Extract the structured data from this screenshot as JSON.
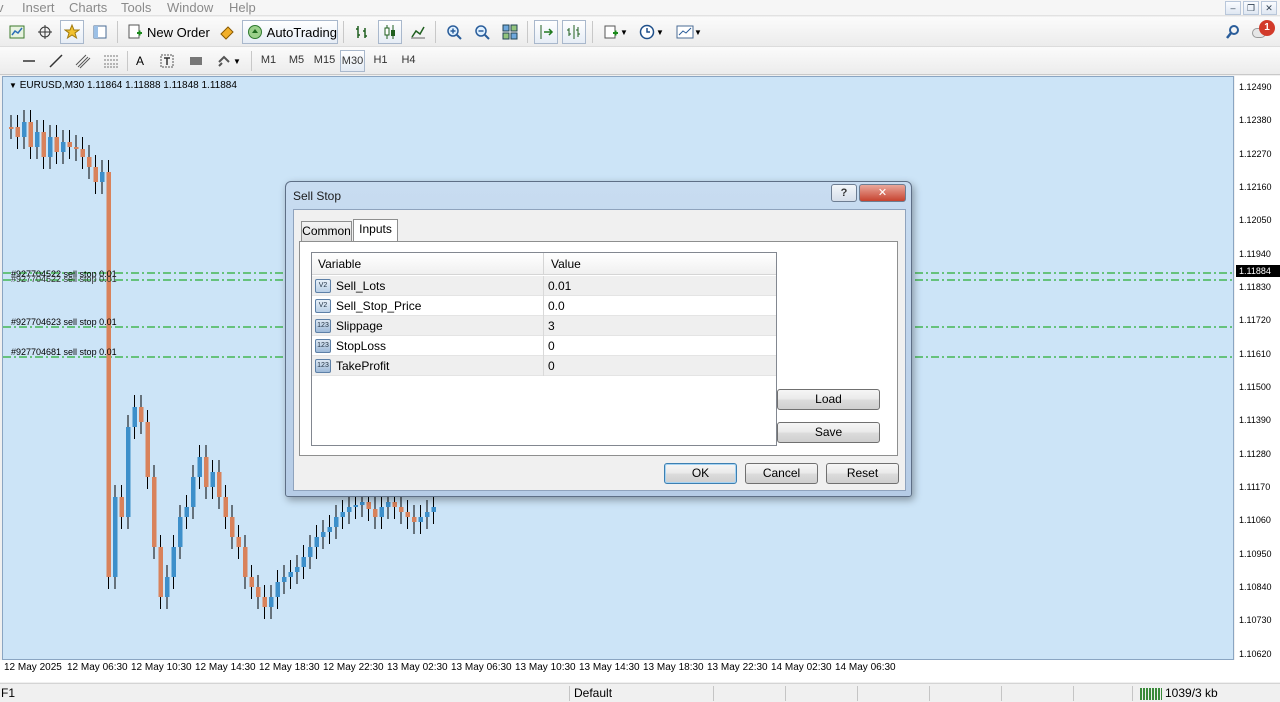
{
  "menu": {
    "items": [
      "Insert",
      "Charts",
      "Tools",
      "Window",
      "Help"
    ]
  },
  "toolbar": {
    "new_order_label": "New Order",
    "autotrading_label": "AutoTrading"
  },
  "timeframes": [
    "M1",
    "M5",
    "M15",
    "M30",
    "H1",
    "H4"
  ],
  "timeframe_active": "M30",
  "chart": {
    "title": "EURUSD,M30  1.11864 1.11888 1.11848 1.11884",
    "order_labels": [
      "#927704522 sell stop 0.01",
      "#927704623 sell stop 0.01",
      "#927704681 sell stop 0.01"
    ],
    "price_ticks": [
      "1.12490",
      "1.12380",
      "1.12270",
      "1.12160",
      "1.12050",
      "1.11940",
      "1.11830",
      "1.11720",
      "1.11610",
      "1.11500",
      "1.11390",
      "1.11280",
      "1.11170",
      "1.11060",
      "1.10950",
      "1.10840",
      "1.10730",
      "1.10620"
    ],
    "current_price": "1.11884",
    "time_ticks": [
      "12 May 2025",
      "12 May 06:30",
      "12 May 10:30",
      "12 May 14:30",
      "12 May 18:30",
      "12 May 22:30",
      "13 May 02:30",
      "13 May 06:30",
      "13 May 10:30",
      "13 May 14:30",
      "13 May 18:30",
      "13 May 22:30",
      "14 May 02:30",
      "14 May 06:30"
    ]
  },
  "dialog": {
    "title": "Sell Stop",
    "help_glyph": "?",
    "close_glyph": "✕",
    "tabs": [
      "Common",
      "Inputs"
    ],
    "active_tab": "Inputs",
    "columns": {
      "variable": "Variable",
      "value": "Value"
    },
    "rows": [
      {
        "name": "Sell_Lots",
        "value": "0.01",
        "type_icon": "V2"
      },
      {
        "name": "Sell_Stop_Price",
        "value": "0.0",
        "type_icon": "V2"
      },
      {
        "name": "Slippage",
        "value": "3",
        "type_icon": "123"
      },
      {
        "name": "StopLoss",
        "value": "0",
        "type_icon": "123"
      },
      {
        "name": "TakeProfit",
        "value": "0",
        "type_icon": "123"
      }
    ],
    "load_label": "Load",
    "save_label": "Save",
    "ok_label": "OK",
    "cancel_label": "Cancel",
    "reset_label": "Reset"
  },
  "status": {
    "help_key": "F1",
    "profile": "Default",
    "traffic": "1039/3 kb"
  },
  "notifications": {
    "count": "1"
  },
  "colors": {
    "chart_bg": "#cce4f7",
    "bull": "#3d8fca",
    "bear": "#d9825b",
    "order_line": "#00a000",
    "accent": "#3c7fb1"
  }
}
